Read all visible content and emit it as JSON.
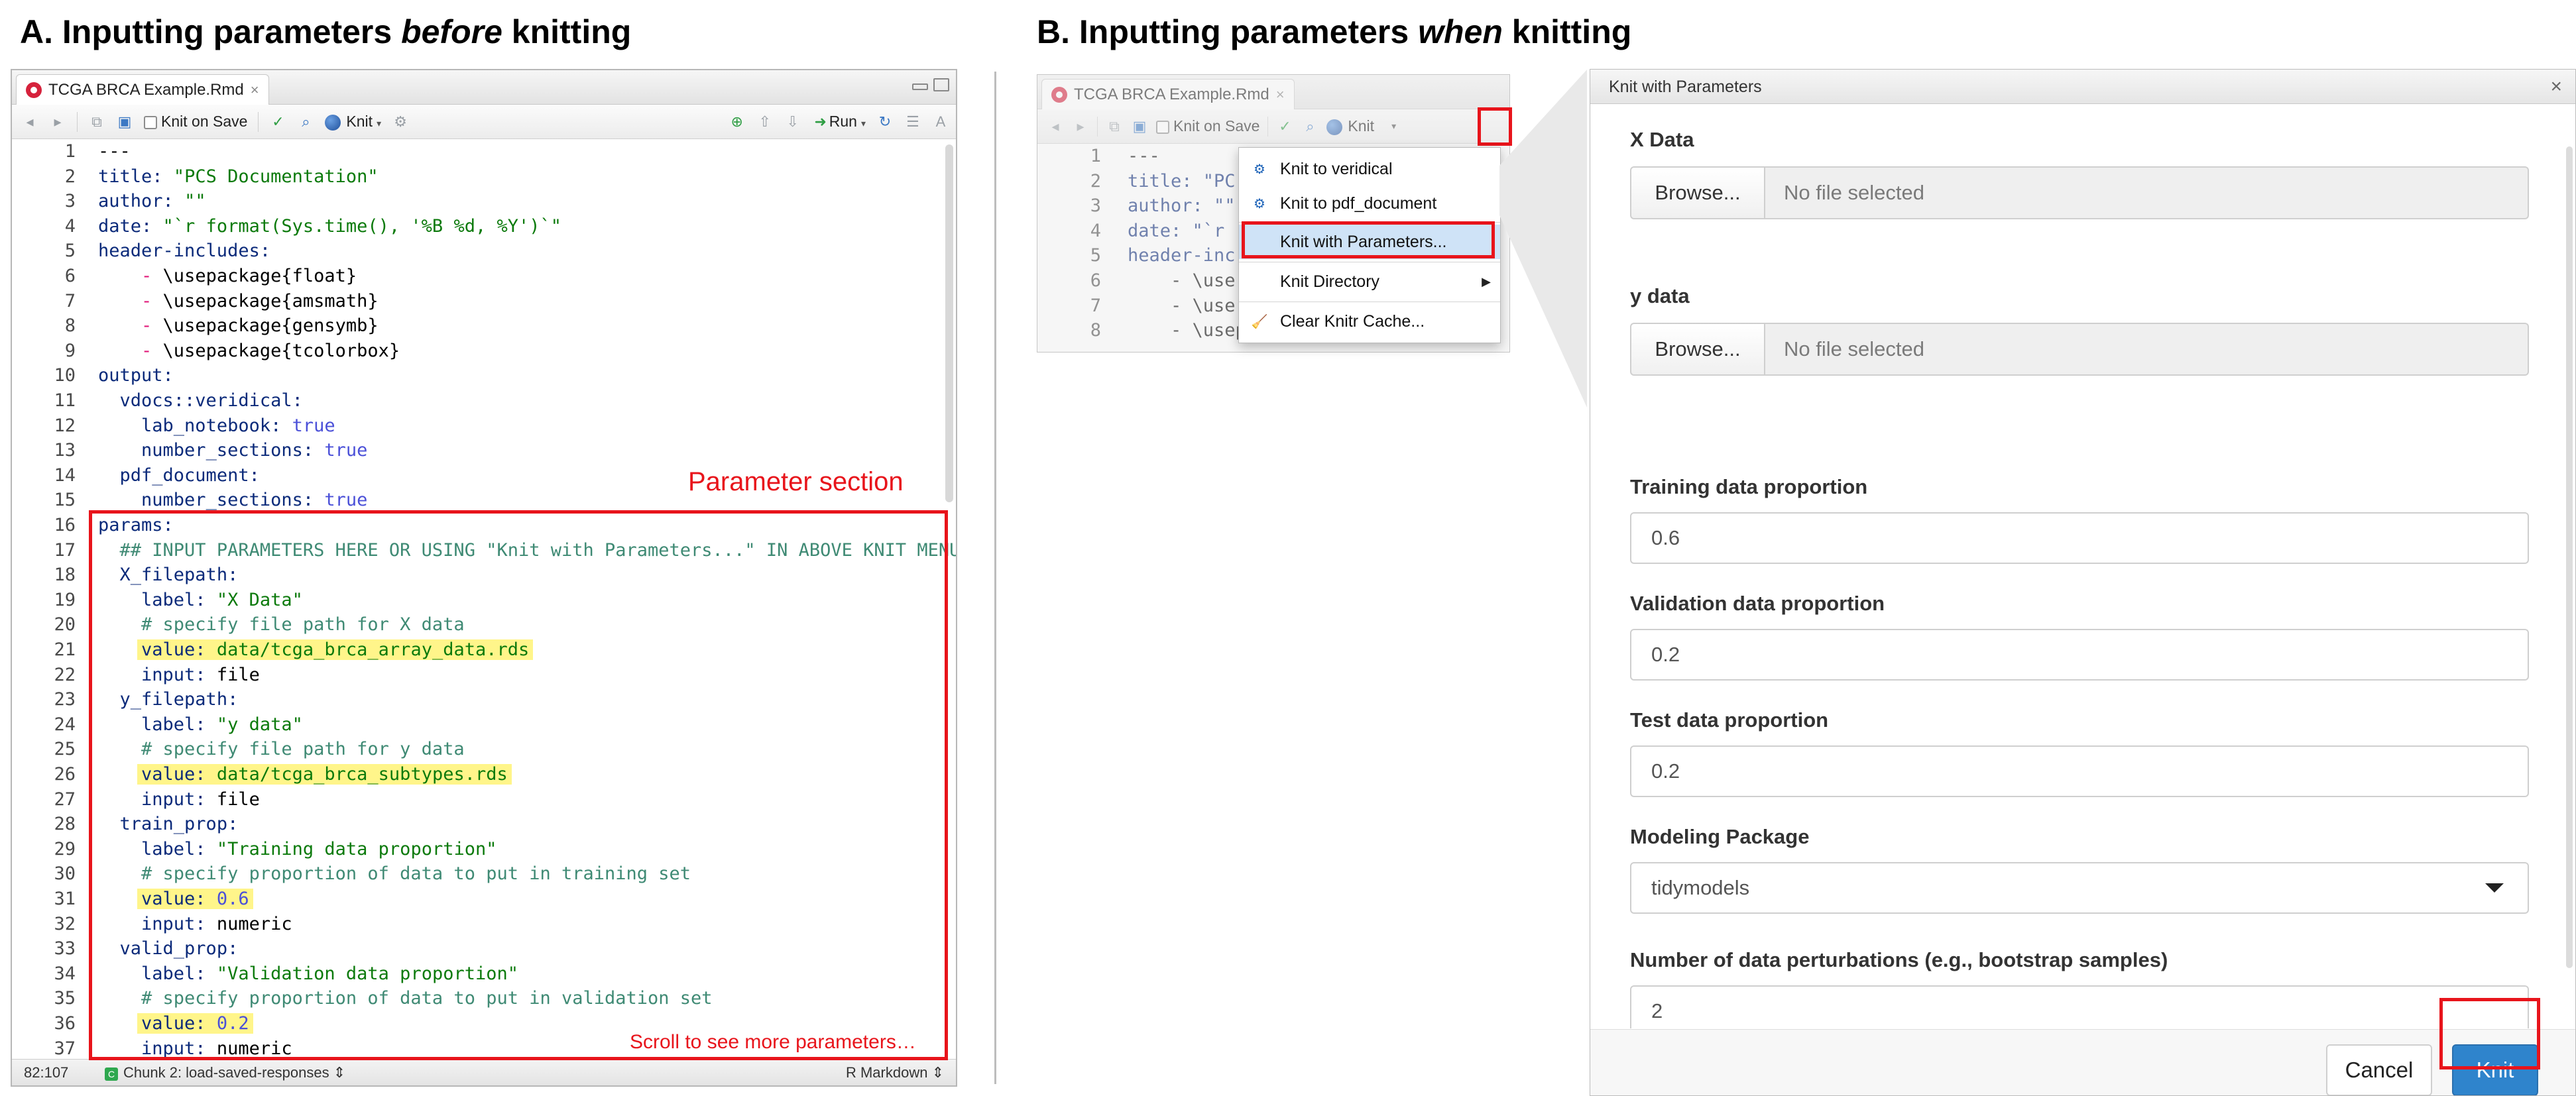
{
  "headings": {
    "a": {
      "prefix": "A.  Inputting parameters ",
      "em": "before",
      "suffix": " knitting"
    },
    "b": {
      "prefix": "B.  Inputting parameters ",
      "em": "when",
      "suffix": " knitting"
    }
  },
  "editor": {
    "tab_title": "TCGA BRCA Example.Rmd",
    "toolbar": {
      "knit_on_save": "Knit on Save",
      "knit": "Knit",
      "run": "Run"
    },
    "param_section_label": "Parameter section",
    "scroll_note": "Scroll to see more parameters…",
    "status": {
      "position": "82:107",
      "chunk": "Chunk 2: load-saved-responses",
      "mode": "R Markdown"
    }
  },
  "editor_b": {
    "tab_title": "TCGA BRCA Example.Rmd",
    "toolbar": {
      "knit_on_save": "Knit on Save",
      "knit": "Knit"
    },
    "lines": [
      {
        "n": "1",
        "t": "---"
      },
      {
        "n": "2",
        "t": "title: \"PC"
      },
      {
        "n": "3",
        "t": "author: \"\""
      },
      {
        "n": "4",
        "t": "date: \"`r"
      },
      {
        "n": "5",
        "t": "header-inc"
      },
      {
        "n": "6",
        "t": "    - \\use"
      },
      {
        "n": "7",
        "t": "    - \\use"
      },
      {
        "n": "8",
        "t": "    - \\usepackage{gensymb}"
      }
    ]
  },
  "knit_menu": {
    "items": [
      {
        "label": "Knit to veridical",
        "icon": "gear-icon"
      },
      {
        "label": "Knit to pdf_document",
        "icon": "gear-icon"
      },
      {
        "label": "Knit with Parameters...",
        "icon": "gear-icon"
      },
      {
        "label": "Knit Directory",
        "icon": ""
      },
      {
        "label": "Clear Knitr Cache...",
        "icon": "broom-icon"
      }
    ]
  },
  "dialog": {
    "title": "Knit with Parameters",
    "x_data_label": "X Data",
    "y_data_label": "y data",
    "browse": "Browse...",
    "no_file": "No file selected",
    "train_label": "Training data proportion",
    "train_value": "0.6",
    "valid_label": "Validation data proportion",
    "valid_value": "0.2",
    "test_label": "Test data proportion",
    "test_value": "0.2",
    "pkg_label": "Modeling Package",
    "pkg_value": "tidymodels",
    "perturb_label": "Number of data perturbations (e.g., bootstrap samples)",
    "perturb_value": "2",
    "cancel": "Cancel",
    "knit": "Knit"
  },
  "colors": {
    "annotation_red": "#e8141b",
    "highlight_yellow": "#fff58a",
    "knit_blue": "#2f84cc"
  }
}
